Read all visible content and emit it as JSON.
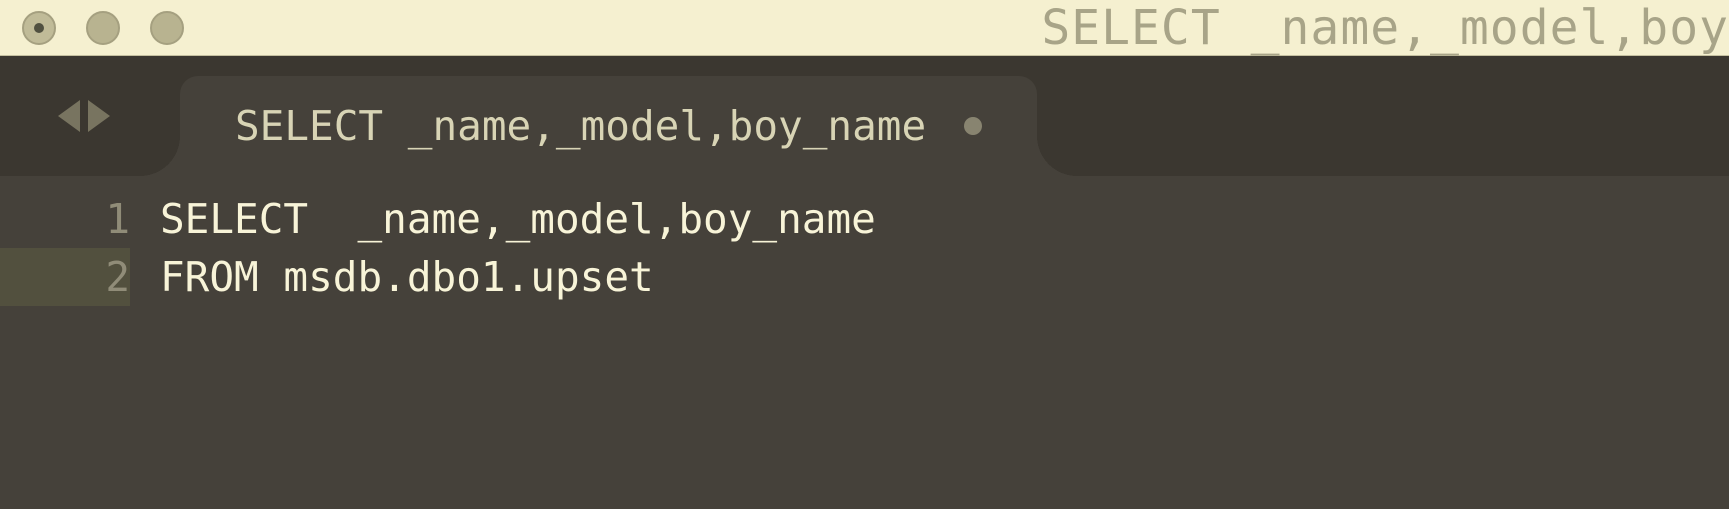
{
  "window": {
    "title": "SELECT  _name,_model,boy"
  },
  "tab": {
    "label": "SELECT  _name,_model,boy_name"
  },
  "editor": {
    "lines": [
      {
        "num": "1",
        "text": "SELECT  _name,_model,boy_name"
      },
      {
        "num": "2",
        "text": "FROM msdb.dbo1.upset"
      }
    ]
  }
}
